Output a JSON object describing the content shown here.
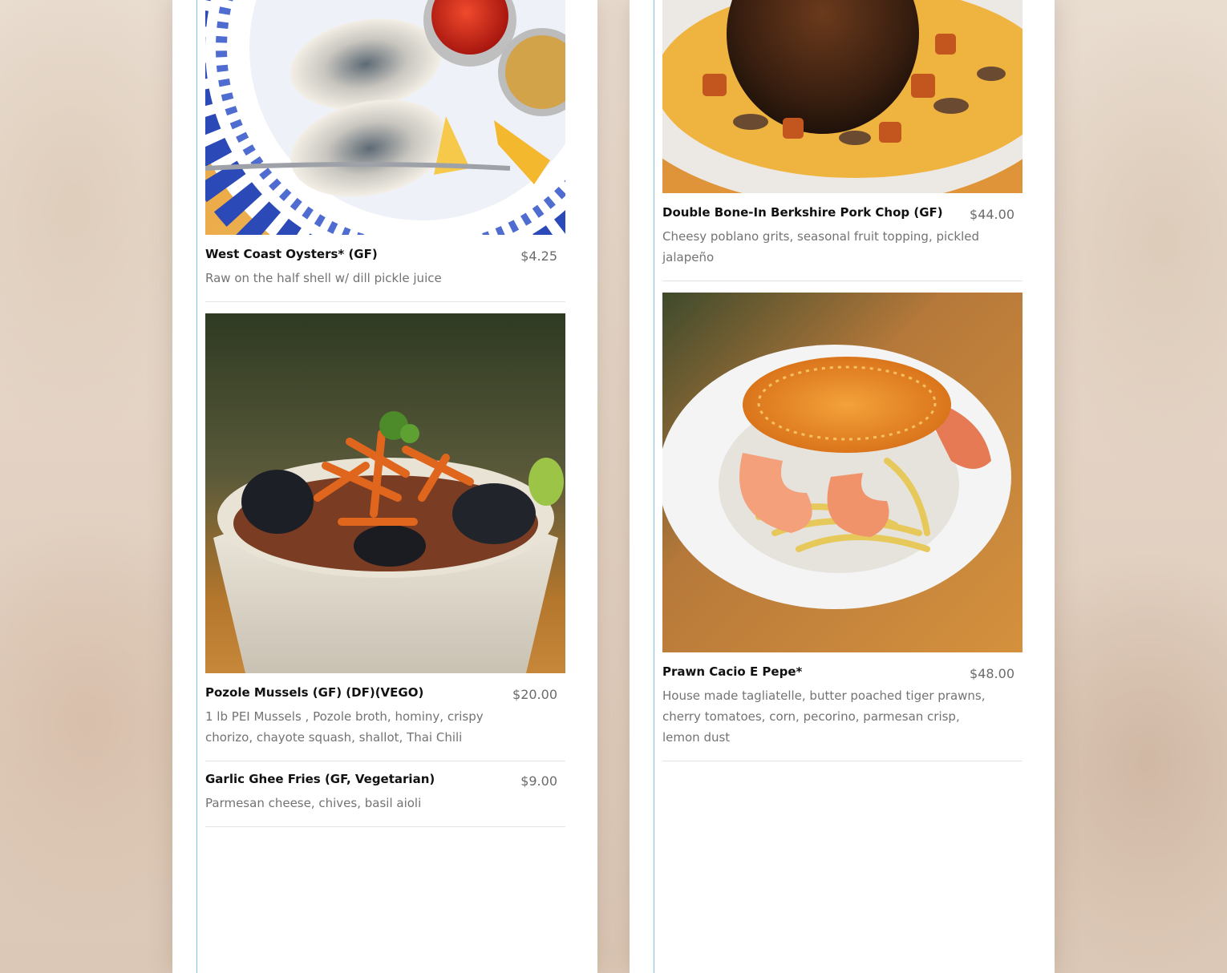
{
  "menu": {
    "left_column": [
      {
        "name": "West Coast Oysters* (GF)",
        "price": "$4.25",
        "description": "Raw on the half shell w/ dill pickle juice",
        "photo": "oysters-photo"
      },
      {
        "name": "Pozole Mussels (GF) (DF)(VEGO)",
        "price": "$20.00",
        "description": "1 lb PEI Mussels , Pozole broth, hominy, crispy chorizo, chayote squash, shallot, Thai Chili",
        "photo": "mussels-photo"
      },
      {
        "name": "Garlic Ghee Fries (GF, Vegetarian)",
        "price": "$9.00",
        "description": "Parmesan cheese, chives, basil aioli"
      }
    ],
    "right_column": [
      {
        "name": "Double Bone-In Berkshire Pork Chop (GF)",
        "price": "$44.00",
        "description": "Cheesy poblano grits, seasonal fruit topping, pickled jalapeño",
        "photo": "pork-chop-photo"
      },
      {
        "name": "Prawn Cacio E Pepe*",
        "price": "$48.00",
        "description": "House made tagliatelle, butter poached tiger prawns, cherry tomatoes, corn, pecorino, parmesan crisp, lemon dust",
        "photo": "prawn-pasta-photo"
      }
    ]
  },
  "colors": {
    "column_rule": "#79c7e3",
    "item_name": "#111111",
    "item_price": "#6b6b6b",
    "item_description": "#737373",
    "divider": "#e3e3e3"
  }
}
